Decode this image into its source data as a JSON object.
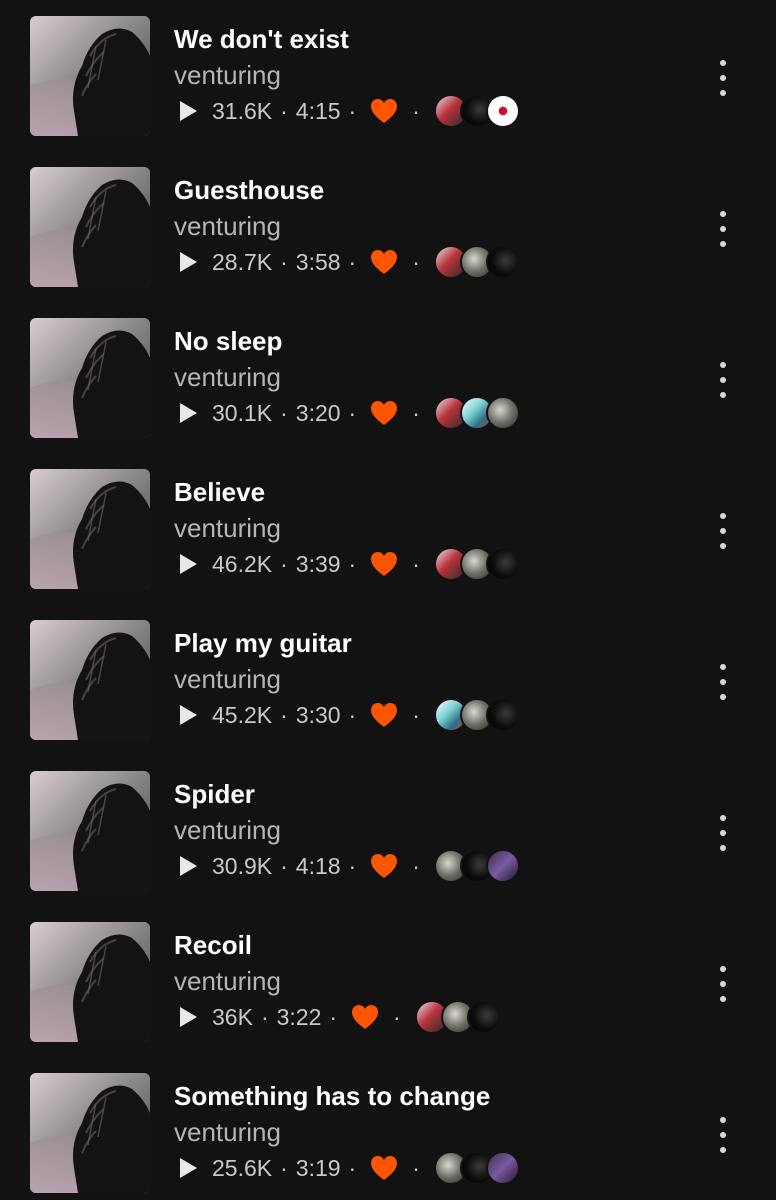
{
  "tracks": [
    {
      "title": "We don't exist",
      "artist": "venturing",
      "plays": "31.6K",
      "duration": "4:15",
      "commenters": [
        "mixed",
        "dark",
        "white"
      ]
    },
    {
      "title": "Guesthouse",
      "artist": "venturing",
      "plays": "28.7K",
      "duration": "3:58",
      "commenters": [
        "mixed",
        "grey",
        "dark"
      ]
    },
    {
      "title": "No sleep",
      "artist": "venturing",
      "plays": "30.1K",
      "duration": "3:20",
      "commenters": [
        "mixed",
        "teal",
        "grey"
      ]
    },
    {
      "title": "Believe",
      "artist": "venturing",
      "plays": "46.2K",
      "duration": "3:39",
      "commenters": [
        "mixed",
        "grey",
        "dark"
      ]
    },
    {
      "title": "Play my guitar",
      "artist": "venturing",
      "plays": "45.2K",
      "duration": "3:30",
      "commenters": [
        "teal",
        "grey",
        "dark"
      ]
    },
    {
      "title": "Spider",
      "artist": "venturing",
      "plays": "30.9K",
      "duration": "4:18",
      "commenters": [
        "grey",
        "dark",
        "purple"
      ]
    },
    {
      "title": "Recoil",
      "artist": "venturing",
      "plays": "36K",
      "duration": "3:22",
      "commenters": [
        "mixed",
        "grey",
        "dark"
      ]
    },
    {
      "title": "Something has to change",
      "artist": "venturing",
      "plays": "25.6K",
      "duration": "3:19",
      "commenters": [
        "grey",
        "dark",
        "purple"
      ]
    }
  ],
  "icons": {
    "play": "play-icon",
    "like": "heart-icon",
    "more": "more-vertical-icon"
  },
  "colors": {
    "background": "#121212",
    "title": "#ffffff",
    "artist": "#b5b5b5",
    "meta": "#c9c9c9",
    "heart": "#ff5500"
  }
}
